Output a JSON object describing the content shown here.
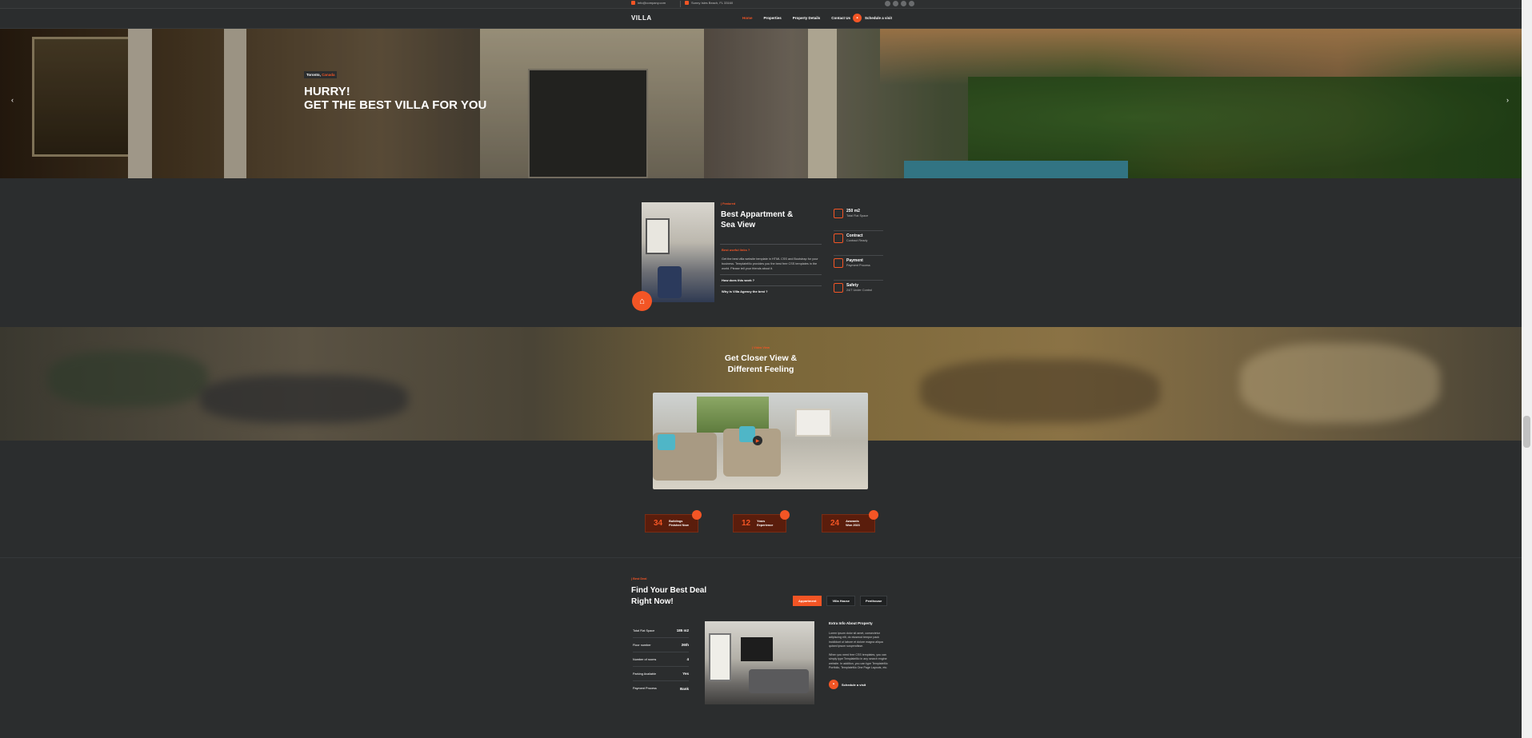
{
  "topbar": {
    "email": "info@company.com",
    "address": "Sunny Isles Beach, FL 33160",
    "socials": [
      "facebook-icon",
      "twitter-icon",
      "linkedin-icon",
      "instagram-icon"
    ]
  },
  "nav": {
    "logo": "VILLA",
    "items": [
      "Home",
      "Properties",
      "Property Details",
      "Contact Us"
    ],
    "active_index": 0,
    "schedule_label": "Schedule a visit"
  },
  "hero": {
    "city": "Toronto,",
    "country": "Canada",
    "line1": "Hurry!",
    "line2": "Get the Best Villa for you",
    "prev": "‹",
    "next": "›"
  },
  "featured": {
    "small": "| Featured",
    "title": "Best Appartment & Sea View",
    "accordion": [
      {
        "q": "Best useful links ?",
        "a": "Get the best villa website template in HTML CSS and Bootstrap for your business. TemplateMo provides you the best free CSS templates in the world. Please tell your friends about it."
      },
      {
        "q": "How does this work ?",
        "a": ""
      },
      {
        "q": "Why is Villa Agency the best ?",
        "a": ""
      }
    ],
    "stats": [
      {
        "title": "250 m2",
        "sub": "Total Flat Space"
      },
      {
        "title": "Contract",
        "sub": "Contract Ready"
      },
      {
        "title": "Payment",
        "sub": "Payment Process"
      },
      {
        "title": "Safety",
        "sub": "24/7 Under Control"
      }
    ]
  },
  "video": {
    "small": "| Video View",
    "title": "Get Closer View & Different Feeling"
  },
  "counters": [
    {
      "number": "34",
      "line1": "Buildings",
      "line2": "Finished Now"
    },
    {
      "number": "12",
      "line1": "Years",
      "line2": "Experience"
    },
    {
      "number": "24",
      "line1": "Awwards",
      "line2": "Won 2023"
    }
  ],
  "deal": {
    "small": "| Best Deal",
    "title": "Find Your Best Deal Right Now!",
    "tabs": [
      "Appartment",
      "Villa House",
      "Penthouse"
    ],
    "active_tab": 0,
    "table": [
      {
        "label": "Total Flat Space",
        "value": "185 m2"
      },
      {
        "label": "Floor number",
        "value": "26th"
      },
      {
        "label": "Number of rooms",
        "value": "4"
      },
      {
        "label": "Parking Available",
        "value": "Yes"
      },
      {
        "label": "Payment Process",
        "value": "Bank"
      }
    ],
    "extra_title": "Extra Info About Property",
    "extra_p1": "Lorem ipsum dolor sit amet, consectetur adipiscing elit, do eiusmod tempor pack incididunt ut labore et dolore magna aliqua quised ipsum suspendisse.",
    "extra_p2": "When you need free CSS templates, you can simply type TemplateMo in any search engine website. In addition, you can type TemplateMo Portfolio, TemplateMo One Page Layouts, etc.",
    "extra_button": "Schedule a visit"
  },
  "colors": {
    "accent": "#f35525",
    "background": "#2b2d2e"
  }
}
